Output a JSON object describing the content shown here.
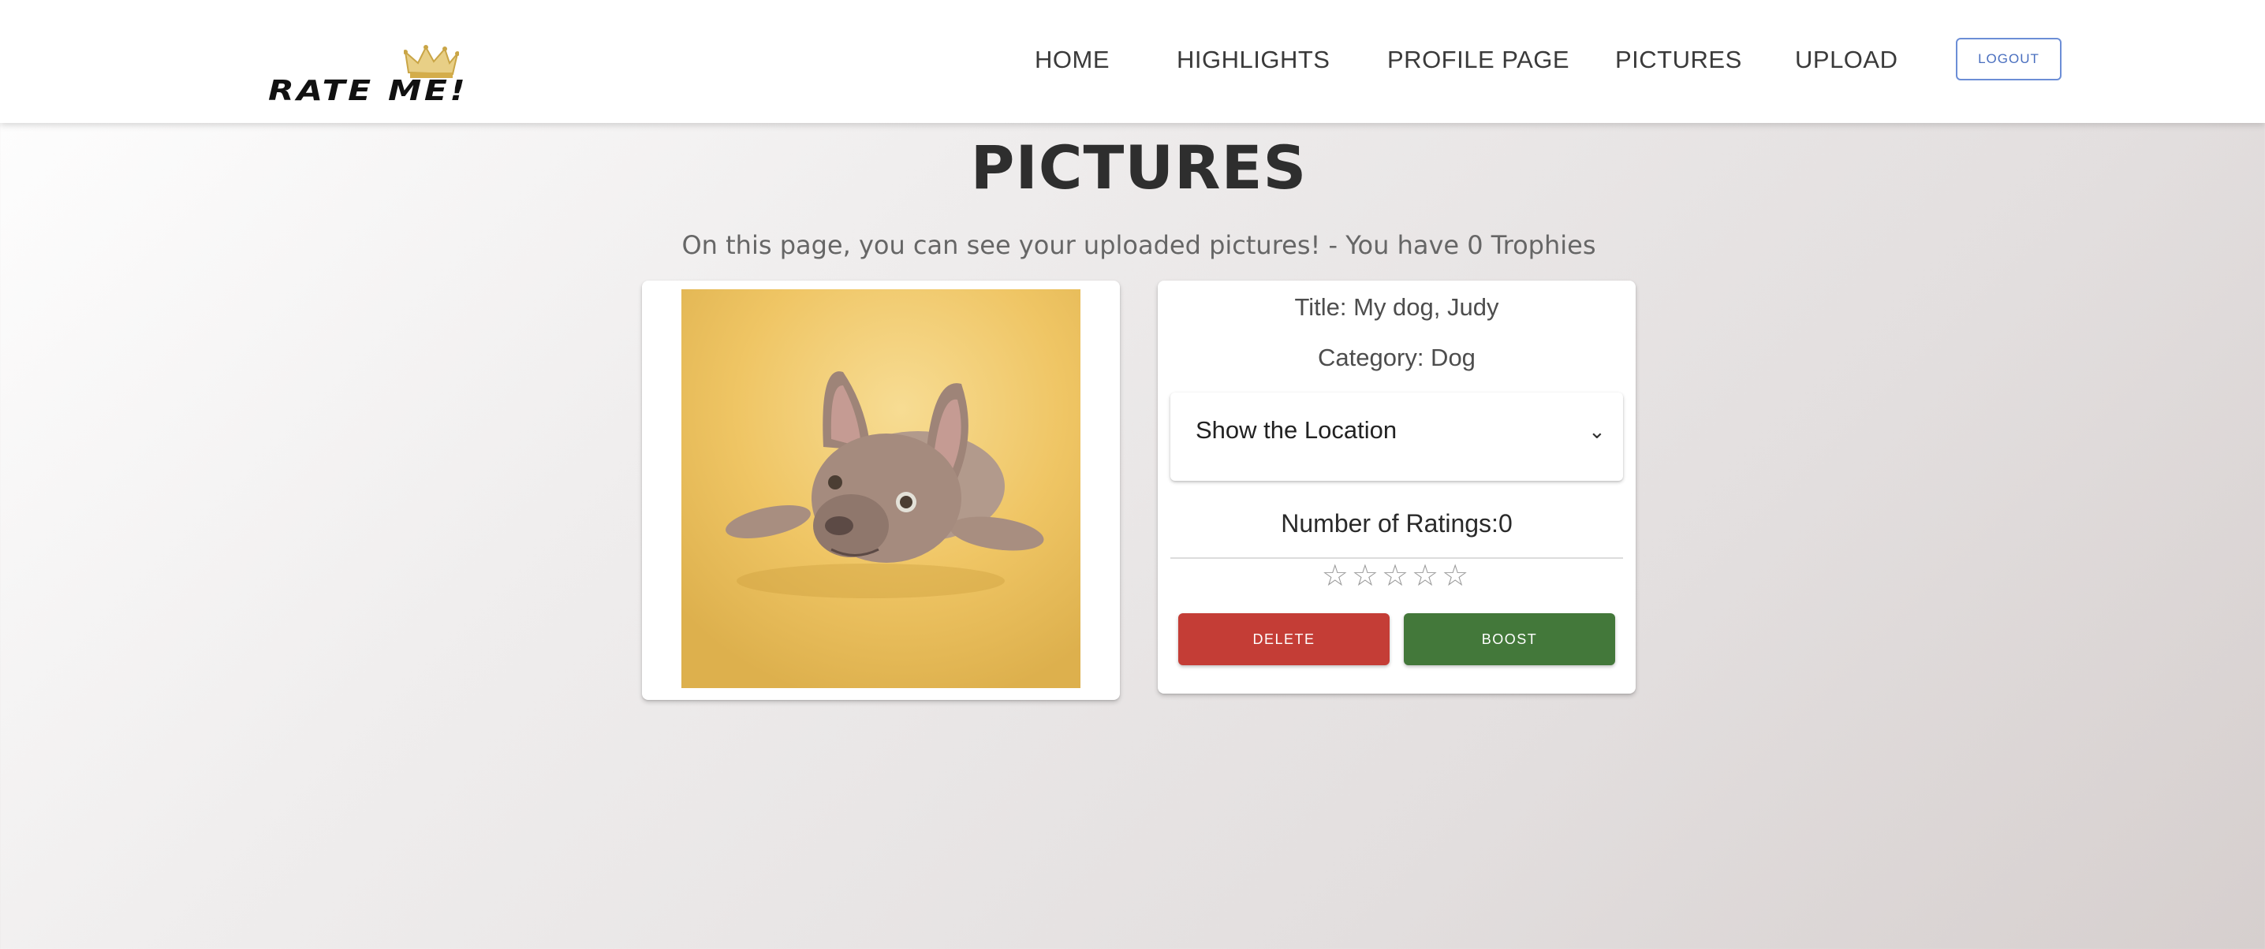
{
  "brand": {
    "logo_text": "RATE ME!",
    "crown_color": "#d4ad4a"
  },
  "nav": {
    "items": [
      {
        "label": "HOME"
      },
      {
        "label": "HIGHLIGHTS"
      },
      {
        "label": "PROFILE PAGE"
      },
      {
        "label": "PICTURES"
      },
      {
        "label": "UPLOAD"
      }
    ],
    "logout_label": "LOGOUT"
  },
  "page": {
    "title": "PICTURES",
    "subtitle": "On this page, you can see your uploaded pictures! - You have 0 Trophies"
  },
  "picture": {
    "image_subject": "french-bulldog-photo",
    "title": "Title: My dog, Judy",
    "category": "Category: Dog",
    "location_toggle": "Show the Location",
    "ratings_count": "Number of Ratings:0",
    "rating": {
      "filled": 0,
      "max": 5
    },
    "delete_label": "DELETE",
    "boost_label": "BOOST"
  },
  "colors": {
    "delete": "#c43d36",
    "boost": "#43783a",
    "logout_border": "#6c8ed6"
  },
  "icons": {
    "chevron": "chevron-down-icon",
    "star": "star-outline-icon"
  }
}
